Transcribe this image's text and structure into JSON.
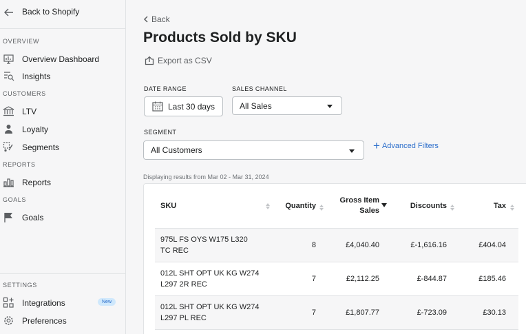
{
  "sidebar": {
    "back_label": "Back to Shopify",
    "sections": {
      "overview": "OVERVIEW",
      "customers": "CUSTOMERS",
      "reports": "REPORTS",
      "goals": "GOALS",
      "settings": "SETTINGS"
    },
    "items": {
      "overview_dashboard": "Overview Dashboard",
      "insights": "Insights",
      "ltv": "LTV",
      "loyalty": "Loyalty",
      "segments": "Segments",
      "reports": "Reports",
      "goals": "Goals",
      "integrations": "Integrations",
      "integrations_badge": "New",
      "preferences": "Preferences"
    }
  },
  "main": {
    "back_label": "Back",
    "title": "Products Sold by SKU",
    "export_label": "Export as CSV",
    "filters": {
      "date_range_label": "DATE RANGE",
      "date_range_value": "Last 30 days",
      "sales_channel_label": "SALES CHANNEL",
      "sales_channel_value": "All Sales",
      "segment_label": "SEGMENT",
      "segment_value": "All Customers",
      "advanced_filters": "Advanced Filters"
    },
    "results_text": "Displaying results from Mar 02 - Mar 31, 2024",
    "table": {
      "headers": {
        "sku": "SKU",
        "quantity": "Quantity",
        "gross_line1": "Gross Item",
        "gross_line2": "Sales",
        "discounts": "Discounts",
        "tax": "Tax"
      },
      "rows": [
        {
          "sku_line1": "975L FS OYS W175 L320",
          "sku_line2": "TC REC",
          "quantity": "8",
          "gross": "£4,040.40",
          "discounts": "£-1,616.16",
          "tax": "£404.04"
        },
        {
          "sku_line1": "012L SHT OPT UK KG W274",
          "sku_line2": "L297 2R REC",
          "quantity": "7",
          "gross": "£2,112.25",
          "discounts": "£-844.87",
          "tax": "£185.46"
        },
        {
          "sku_line1": "012L SHT OPT UK KG W274",
          "sku_line2": "L297 PL REC",
          "quantity": "7",
          "gross": "£1,807.77",
          "discounts": "£-723.09",
          "tax": "£30.13"
        }
      ]
    }
  },
  "colors": {
    "accent": "#2c6ecb",
    "text": "#202223",
    "muted": "#5c5f62",
    "border": "#e1e3e5"
  }
}
